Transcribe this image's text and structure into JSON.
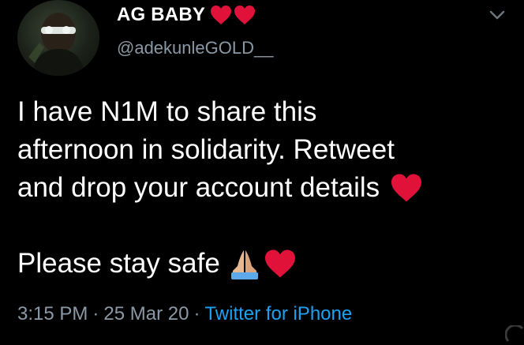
{
  "header": {
    "display_name": "AG BABY",
    "name_emojis": [
      "heart-icon",
      "heart-icon"
    ],
    "handle": "@adekunleGOLD__"
  },
  "tweet": {
    "lines": [
      "I have N1M to share this",
      "afternoon in solidarity. Retweet",
      "and drop your account details"
    ],
    "closing_line": "Please stay safe",
    "emoji_color": "#e0123a"
  },
  "meta": {
    "time": "3:15 PM",
    "date": "25 Mar 20",
    "source": "Twitter for iPhone",
    "separator": "·",
    "source_color": "#1da1f2"
  }
}
